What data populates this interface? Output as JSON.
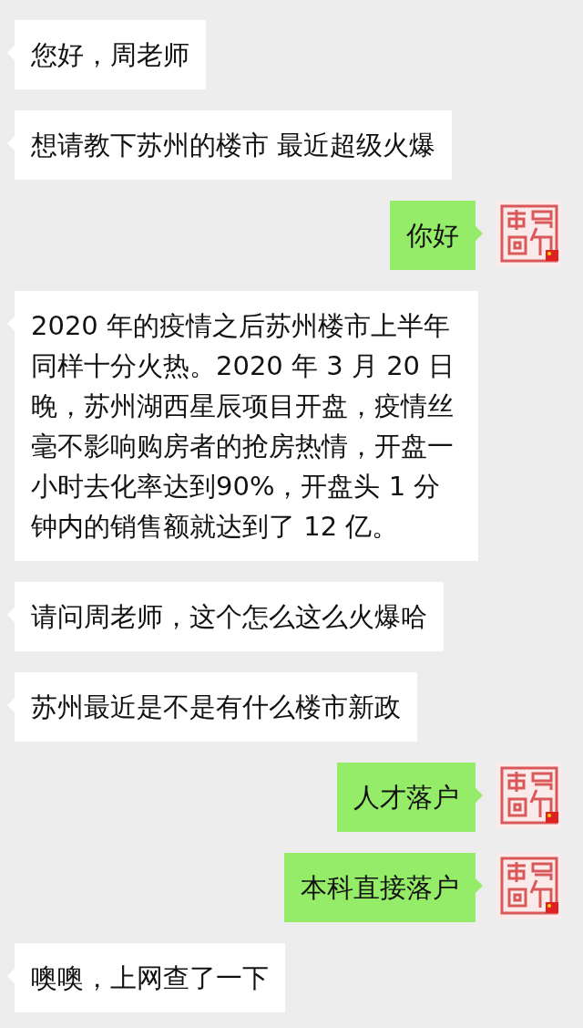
{
  "messages": [
    {
      "kind": "received",
      "text": "您好，周老师"
    },
    {
      "kind": "received",
      "text": "想请教下苏州的楼市  最近超级火爆"
    },
    {
      "kind": "sent",
      "text": "你好"
    },
    {
      "kind": "received",
      "text": "2020 年的疫情之后苏州楼市上半年同样十分火热。2020 年 3 月 20 日晚，苏州湖西星辰项目开盘，疫情丝毫不影响购房者的抢房热情，开盘一小时去化率达到90%，开盘头 1 分钟内的销售额就达到了 12 亿。"
    },
    {
      "kind": "received",
      "text": "请问周老师，这个怎么这么火爆哈"
    },
    {
      "kind": "received",
      "text": "苏州最近是不是有什么楼市新政"
    },
    {
      "kind": "sent",
      "text": "人才落户"
    },
    {
      "kind": "sent",
      "text": "本科直接落户"
    },
    {
      "kind": "received",
      "text": "噢噢，上网查了一下"
    }
  ]
}
